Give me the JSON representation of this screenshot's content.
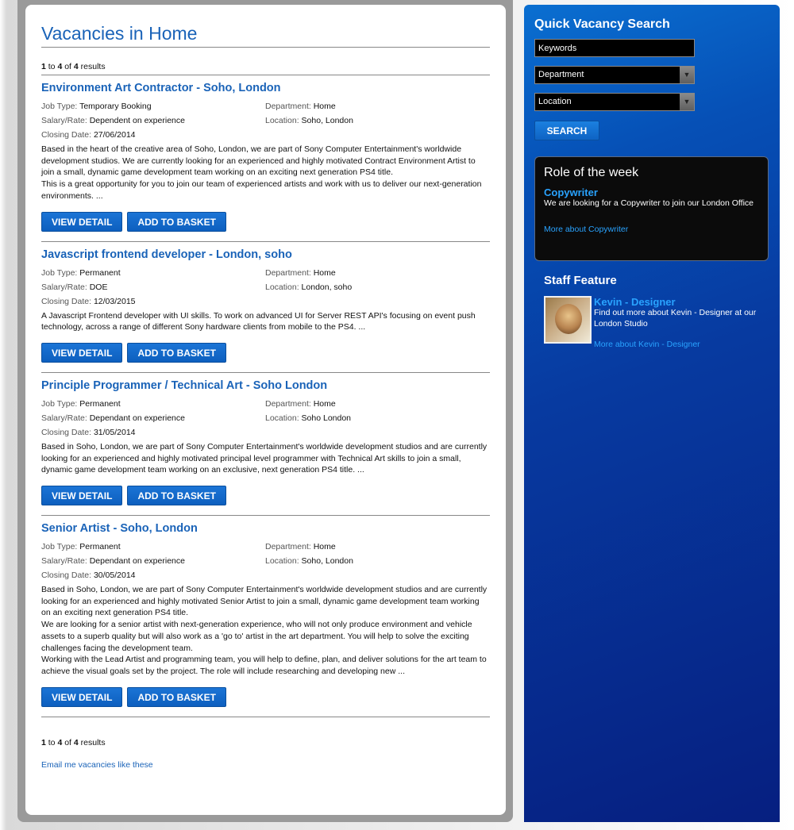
{
  "main": {
    "title": "Vacancies in Home",
    "results": {
      "from": "1",
      "to_word": "to",
      "to": "4",
      "of_word": "of",
      "total": "4",
      "suffix": "results"
    },
    "vacancies": [
      {
        "title": "Environment Art Contractor - Soho, London",
        "job_type_label": "Job Type:",
        "job_type": "Temporary Booking",
        "department_label": "Department:",
        "department": "Home",
        "salary_label": "Salary/Rate:",
        "salary": "Dependent on experience",
        "location_label": "Location:",
        "location": "Soho, London",
        "closing_label": "Closing Date:",
        "closing": "27/06/2014",
        "description": "Based in the heart of the creative area of Soho, London, we are part of Sony Computer Entertainment's worldwide development studios. We are currently looking for an experienced and highly motivated Contract Environment Artist to join a small, dynamic game development team working on an exciting next generation PS4 title.\nThis is a great opportunity for you to join our team of experienced artists and work with us to deliver our next-generation environments. ..."
      },
      {
        "title": "Javascript frontend developer - London, soho",
        "job_type_label": "Job Type:",
        "job_type": "Permanent",
        "department_label": "Department:",
        "department": "Home",
        "salary_label": "Salary/Rate:",
        "salary": "DOE",
        "location_label": "Location:",
        "location": "London, soho",
        "closing_label": "Closing Date:",
        "closing": "12/03/2015",
        "description": "A Javascript Frontend developer with UI skills. To work on advanced UI for Server REST API's focusing on event push technology, across a range of different Sony hardware clients from mobile to the PS4. ..."
      },
      {
        "title": "Principle Programmer / Technical Art - Soho London",
        "job_type_label": "Job Type:",
        "job_type": "Permanent",
        "department_label": "Department:",
        "department": "Home",
        "salary_label": "Salary/Rate:",
        "salary": "Dependant on experience",
        "location_label": "Location:",
        "location": "Soho London",
        "closing_label": "Closing Date:",
        "closing": "31/05/2014",
        "description": "Based in Soho, London, we are part of Sony Computer Entertainment's worldwide development studios and are currently looking for an experienced and highly motivated principal level programmer with Technical Art skills to join a small, dynamic game development team working on an exclusive, next generation PS4 title. ..."
      },
      {
        "title": "Senior Artist - Soho, London",
        "job_type_label": "Job Type:",
        "job_type": "Permanent",
        "department_label": "Department:",
        "department": "Home",
        "salary_label": "Salary/Rate:",
        "salary": "Dependant on experience",
        "location_label": "Location:",
        "location": "Soho, London",
        "closing_label": "Closing Date:",
        "closing": "30/05/2014",
        "description": "Based in Soho, London, we are part of Sony Computer Entertainment's worldwide development studios and are currently looking for an experienced and highly motivated Senior Artist to join a small, dynamic game development team working on an exciting next generation PS4 title.\nWe are looking for a senior artist with next-generation experience, who will not only produce environment and vehicle assets to a superb quality but will also work as a 'go to' artist in the art department. You will help to solve the exciting challenges facing the development team.\nWorking with the Lead Artist and programming team, you will help to define, plan, and deliver solutions for the art team to achieve the visual goals set by the project. The role will include researching and developing new ..."
      }
    ],
    "view_detail_label": "VIEW DETAIL",
    "add_basket_label": "ADD TO BASKET",
    "email_link": "Email me vacancies like these"
  },
  "sidebar": {
    "search_title": "Quick Vacancy Search",
    "keywords_placeholder": "Keywords",
    "department_select": "Department",
    "location_select": "Location",
    "search_label": "SEARCH",
    "role": {
      "heading": "Role of the week",
      "name": "Copywriter",
      "text": "We are looking for a Copywriter to join our London Office",
      "more": "More about Copywriter"
    },
    "staff": {
      "heading": "Staff Feature",
      "name": "Kevin - Designer",
      "text": "Find out more about Kevin - Designer at our London Studio",
      "more": "More about Kevin - Designer"
    }
  },
  "colors": {
    "link_blue": "#1a63b8",
    "button_blue": "#0d6fd1",
    "sidebar_blue": "#073aa0",
    "sidebar_link": "#29a3ff"
  }
}
